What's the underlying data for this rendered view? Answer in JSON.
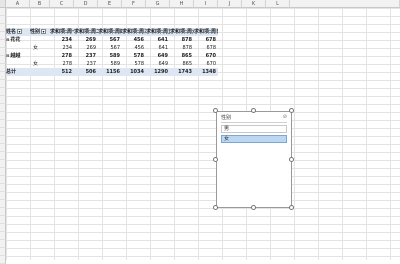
{
  "columns": [
    "A",
    "B",
    "C",
    "D",
    "E",
    "F",
    "G",
    "H",
    "I",
    "J",
    "K",
    "L"
  ],
  "pivot": {
    "header": [
      "姓名",
      "性别",
      "求和项:周一",
      "求和项:周二",
      "求和项:周四",
      "求和项:周三",
      "求和项:周五",
      "求和项:周六",
      "求和项:周日"
    ],
    "rows": [
      {
        "name": "花花",
        "gender": "",
        "values": [
          "234",
          "269",
          "567",
          "456",
          "641",
          "878",
          "678"
        ],
        "group": true
      },
      {
        "name": "",
        "gender": "女",
        "values": [
          "234",
          "269",
          "567",
          "456",
          "641",
          "878",
          "678"
        ],
        "group": false
      },
      {
        "name": "越越",
        "gender": "",
        "values": [
          "278",
          "237",
          "589",
          "578",
          "649",
          "865",
          "670"
        ],
        "group": true
      },
      {
        "name": "",
        "gender": "女",
        "values": [
          "278",
          "237",
          "589",
          "578",
          "649",
          "865",
          "670"
        ],
        "group": false
      },
      {
        "name": "总计",
        "gender": "",
        "values": [
          "512",
          "506",
          "1156",
          "1034",
          "1290",
          "1743",
          "1348"
        ],
        "group": true,
        "total": true
      }
    ],
    "expander_icon": "minus-box-icon",
    "filter_icon": "filter-dropdown-icon"
  },
  "slicer": {
    "title": "性别",
    "clear_icon": "clear-filter-icon",
    "items": [
      {
        "label": "男",
        "selected": false
      },
      {
        "label": "女",
        "selected": true
      }
    ]
  }
}
